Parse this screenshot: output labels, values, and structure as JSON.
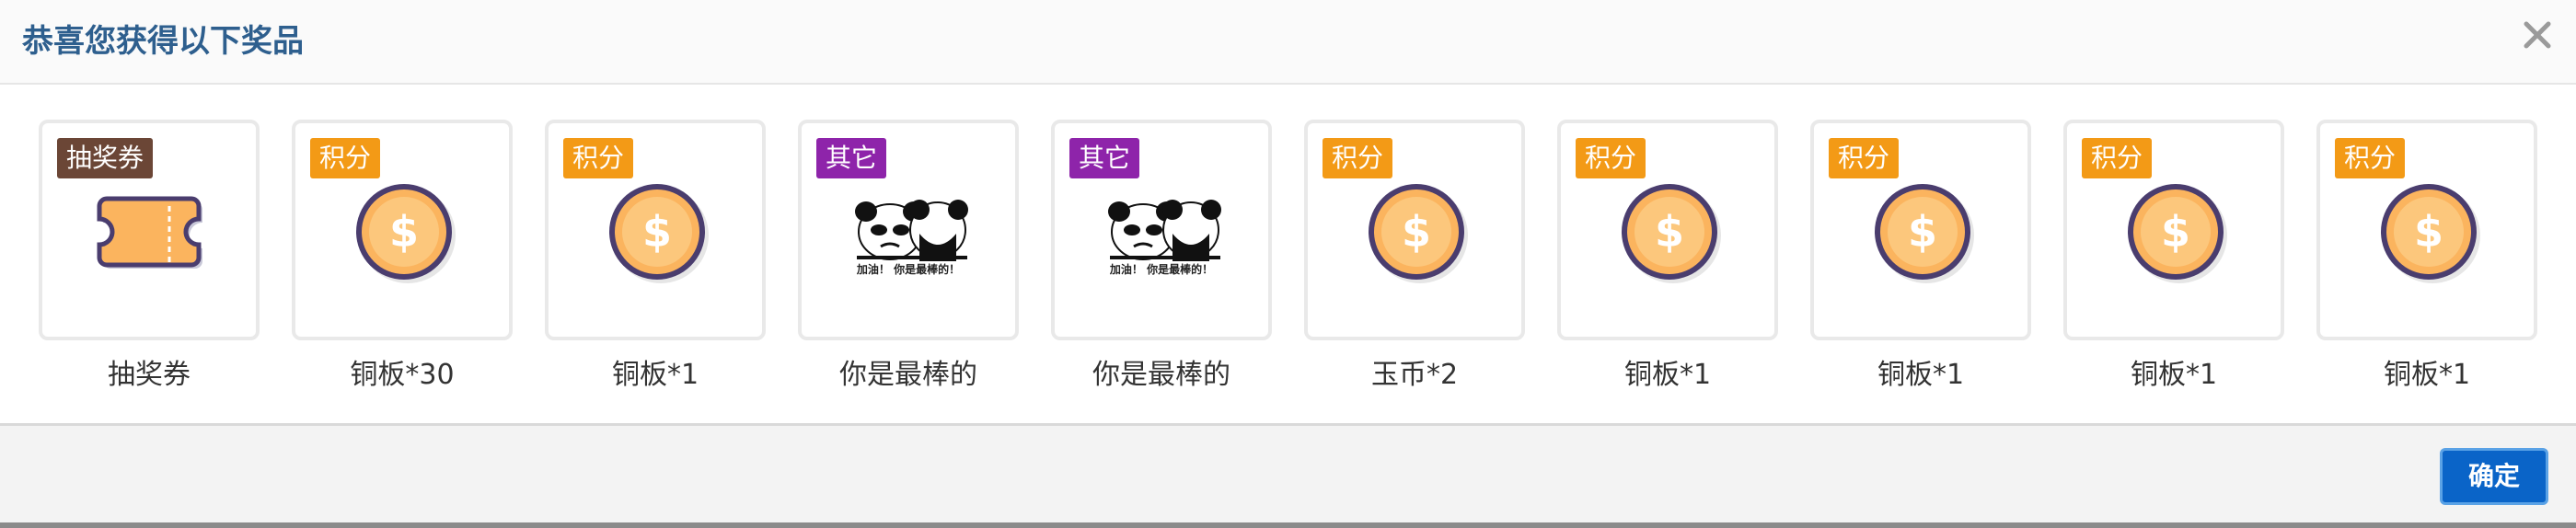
{
  "dialog": {
    "title": "恭喜您获得以下奖品",
    "close_icon": "close-icon",
    "confirm_label": "确定",
    "confirm_color": "#0a64c8"
  },
  "tag_colors": {
    "积分": "#f39a16",
    "其它": "#8e24aa",
    "抽奖券": "#6b4636"
  },
  "prizes": [
    {
      "tag": "抽奖券",
      "name": "抽奖券",
      "icon": "ticket-icon"
    },
    {
      "tag": "积分",
      "name": "铜板*30",
      "icon": "coin-icon"
    },
    {
      "tag": "积分",
      "name": "铜板*1",
      "icon": "coin-icon"
    },
    {
      "tag": "其它",
      "name": "你是最棒的",
      "icon": "panda-meme-image",
      "caption": "加油！ 你是最棒的！"
    },
    {
      "tag": "其它",
      "name": "你是最棒的",
      "icon": "panda-meme-image",
      "caption": "加油！ 你是最棒的！"
    },
    {
      "tag": "积分",
      "name": "玉币*2",
      "icon": "coin-icon"
    },
    {
      "tag": "积分",
      "name": "铜板*1",
      "icon": "coin-icon"
    },
    {
      "tag": "积分",
      "name": "铜板*1",
      "icon": "coin-icon"
    },
    {
      "tag": "积分",
      "name": "铜板*1",
      "icon": "coin-icon"
    },
    {
      "tag": "积分",
      "name": "铜板*1",
      "icon": "coin-icon"
    }
  ]
}
